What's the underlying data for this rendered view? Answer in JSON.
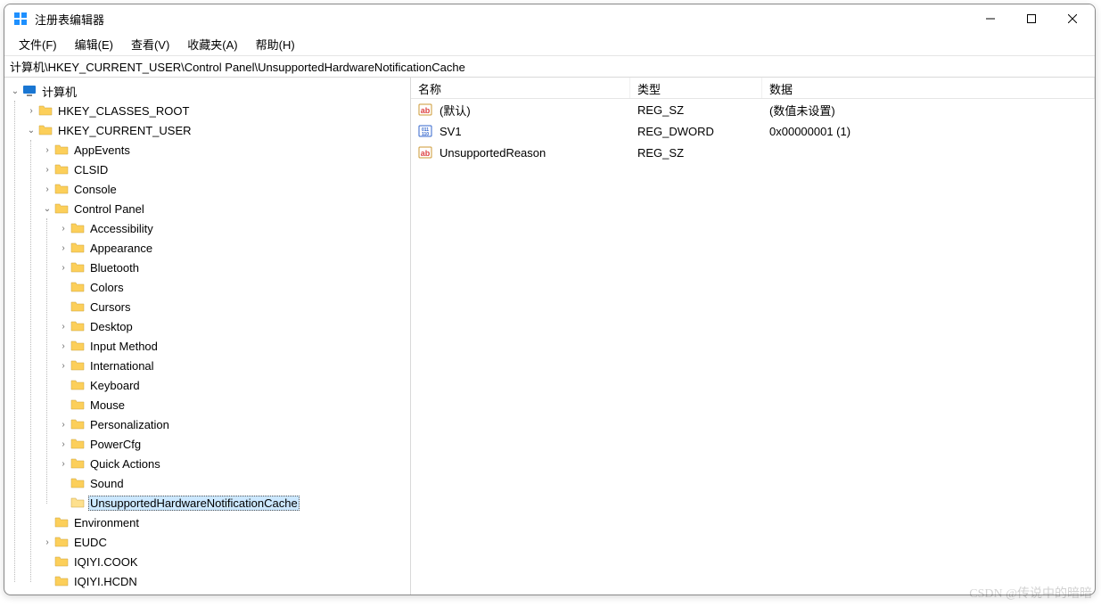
{
  "title": "注册表编辑器",
  "menu": {
    "file": "文件(F)",
    "edit": "编辑(E)",
    "view": "查看(V)",
    "favorites": "收藏夹(A)",
    "help": "帮助(H)"
  },
  "address": "计算机\\HKEY_CURRENT_USER\\Control Panel\\UnsupportedHardwareNotificationCache",
  "tree": {
    "root": "计算机",
    "hives": {
      "hkcr": "HKEY_CLASSES_ROOT",
      "hkcu": "HKEY_CURRENT_USER"
    },
    "hkcu_children": {
      "appevents": "AppEvents",
      "clsid": "CLSID",
      "console": "Console",
      "control_panel": "Control Panel",
      "environment": "Environment",
      "eudc": "EUDC",
      "iqiyi_cook": "IQIYI.COOK",
      "iqiyi_hcdn": "IQIYI.HCDN"
    },
    "control_panel_children": {
      "accessibility": "Accessibility",
      "appearance": "Appearance",
      "bluetooth": "Bluetooth",
      "colors": "Colors",
      "cursors": "Cursors",
      "desktop": "Desktop",
      "input_method": "Input Method",
      "international": "International",
      "keyboard": "Keyboard",
      "mouse": "Mouse",
      "personalization": "Personalization",
      "powercfg": "PowerCfg",
      "quick_actions": "Quick Actions",
      "sound": "Sound",
      "uhnc": "UnsupportedHardwareNotificationCache"
    }
  },
  "list": {
    "headers": {
      "name": "名称",
      "type": "类型",
      "data": "数据"
    },
    "rows": [
      {
        "name": "(默认)",
        "type": "REG_SZ",
        "data": "(数值未设置)",
        "icon": "string",
        "selected": false
      },
      {
        "name": "SV1",
        "type": "REG_DWORD",
        "data": "0x00000001 (1)",
        "icon": "binary",
        "selected": true
      },
      {
        "name": "UnsupportedReason",
        "type": "REG_SZ",
        "data": "",
        "icon": "string",
        "selected": false
      }
    ]
  },
  "watermark": "CSDN @传说中的暗暗"
}
